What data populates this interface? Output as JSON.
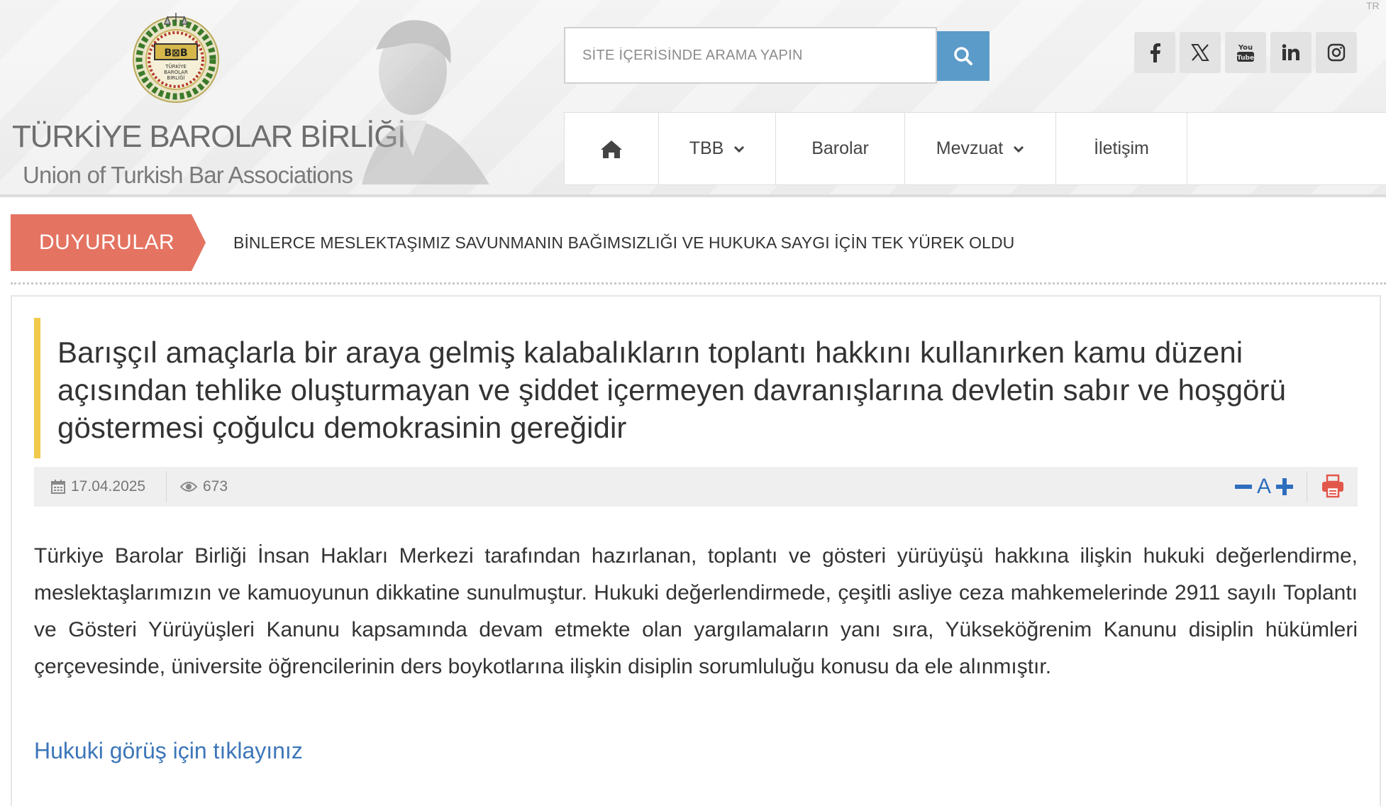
{
  "header": {
    "brand_tr": "TÜRKİYE BAROLAR BİRLİĞİ",
    "brand_en": "Union of Turkish Bar Associations",
    "emblem_text": "TÜRKİYE BAROLAR BİRLİĞİ",
    "search": {
      "placeholder": "SİTE İÇERİSİNDE ARAMA YAPIN"
    },
    "lang": "TR",
    "social": [
      {
        "icon": "facebook-icon",
        "label": "f"
      },
      {
        "icon": "x-icon",
        "label": "𝕏"
      },
      {
        "icon": "youtube-icon",
        "label": "You Tube"
      },
      {
        "icon": "linkedin-icon",
        "label": "in"
      },
      {
        "icon": "instagram-icon",
        "label": ""
      }
    ]
  },
  "nav": {
    "home_icon": "home-icon",
    "tbb": "TBB",
    "barolar": "Barolar",
    "mevzuat": "Mevzuat",
    "iletisim": "İletişim"
  },
  "announcement": {
    "tag": "DUYURULAR",
    "text": "BİNLERCE MESLEKTAŞIMIZ SAVUNMANIN BAĞIMSIZLIĞI VE HUKUKA SAYGI İÇİN TEK YÜREK OLDU"
  },
  "article": {
    "title": "Barışçıl amaçlarla bir araya gelmiş kalabalıkların toplantı hakkını kullanırken kamu düzeni açısından tehlike oluşturmayan ve şiddet içermeyen davranışlarına devletin sabır ve hoşgörü göstermesi çoğulcu demokrasinin gereğidir",
    "date": "17.04.2025",
    "views": "673",
    "font_label": "A",
    "body": "Türkiye Barolar Birliği İnsan Hakları Merkezi tarafından hazırlanan, toplantı ve gösteri yürüyüşü hakkına ilişkin hukuki değerlendirme, meslektaşlarımızın ve kamuoyunun dikkatine sunulmuştur. Hukuki değerlendirmede, çeşitli asliye ceza mahkemelerinde 2911 sayılı Toplantı ve Gösteri Yürüyüşleri Kanunu kapsamında devam etmekte olan yargılamaların yanı sıra, Yükseköğrenim Kanunu disiplin hükümleri çerçevesinde, üniversite öğrencilerinin ders boykotlarına ilişkin disiplin sorumluluğu konusu da ele alınmıştır.",
    "link": "Hukuki görüş için tıklayınız"
  },
  "colors": {
    "accent_blue": "#5b9bc9",
    "announce_red": "#e57361",
    "title_bar_yellow": "#f2c94c",
    "link_blue": "#3d76b8"
  }
}
